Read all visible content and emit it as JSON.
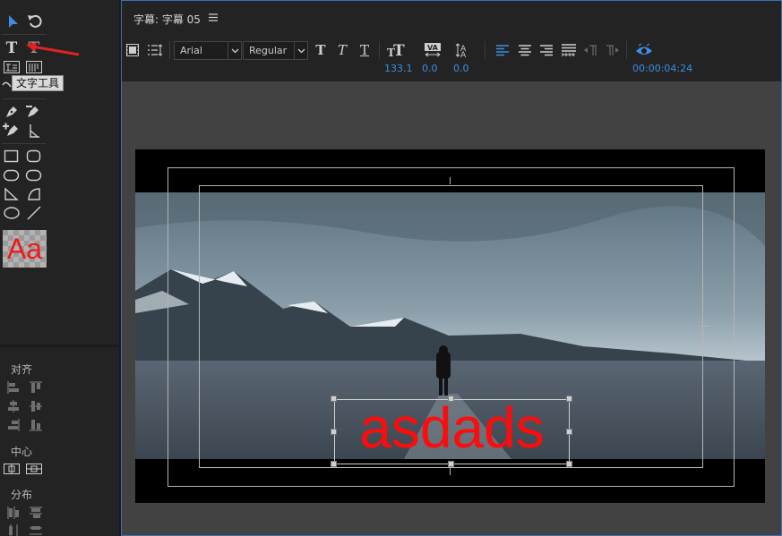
{
  "window": {
    "panel_title": "字幕: 字幕 05",
    "tooltip": "文字工具"
  },
  "toolbar": {
    "font_family": "Arial",
    "font_style": "Regular",
    "font_size": "133.1",
    "kerning": "0.0",
    "leading": "0.0",
    "timecode": "00:00:04:24",
    "text_style_buttons": [
      "bold-T",
      "italic-T",
      "underline-T"
    ],
    "align_buttons": [
      "align-left",
      "align-center",
      "align-right",
      "justify"
    ]
  },
  "tools": {
    "sections": {
      "align": "对齐",
      "center": "中心",
      "distribute": "分布"
    },
    "style_swatch_label": "Aa",
    "icons": [
      "selection-arrow",
      "rotate",
      "type-tool",
      "vertical-type-tool",
      "area-type",
      "vertical-area-type",
      "path-type",
      "pen",
      "delete-anchor",
      "add-anchor",
      "convert-anchor",
      "rectangle",
      "rounded-rectangle",
      "clipped-rectangle",
      "rounded-corner-rectangle",
      "wedge",
      "arc",
      "ellipse",
      "line"
    ]
  },
  "canvas": {
    "title_text": "asdads",
    "text_color": "#ff0b0b",
    "accent_color": "#3c8fe0"
  }
}
